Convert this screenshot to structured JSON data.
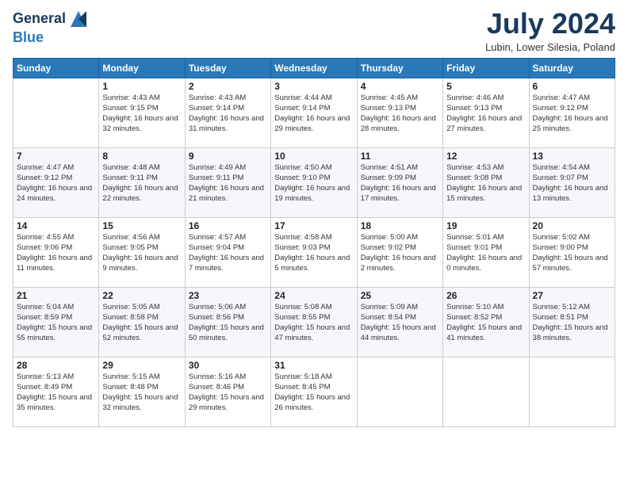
{
  "header": {
    "logo_line1": "General",
    "logo_line2": "Blue",
    "month": "July 2024",
    "location": "Lubin, Lower Silesia, Poland"
  },
  "weekdays": [
    "Sunday",
    "Monday",
    "Tuesday",
    "Wednesday",
    "Thursday",
    "Friday",
    "Saturday"
  ],
  "weeks": [
    [
      {
        "day": "",
        "sunrise": "",
        "sunset": "",
        "daylight": ""
      },
      {
        "day": "1",
        "sunrise": "Sunrise: 4:43 AM",
        "sunset": "Sunset: 9:15 PM",
        "daylight": "Daylight: 16 hours and 32 minutes."
      },
      {
        "day": "2",
        "sunrise": "Sunrise: 4:43 AM",
        "sunset": "Sunset: 9:14 PM",
        "daylight": "Daylight: 16 hours and 31 minutes."
      },
      {
        "day": "3",
        "sunrise": "Sunrise: 4:44 AM",
        "sunset": "Sunset: 9:14 PM",
        "daylight": "Daylight: 16 hours and 29 minutes."
      },
      {
        "day": "4",
        "sunrise": "Sunrise: 4:45 AM",
        "sunset": "Sunset: 9:13 PM",
        "daylight": "Daylight: 16 hours and 28 minutes."
      },
      {
        "day": "5",
        "sunrise": "Sunrise: 4:46 AM",
        "sunset": "Sunset: 9:13 PM",
        "daylight": "Daylight: 16 hours and 27 minutes."
      },
      {
        "day": "6",
        "sunrise": "Sunrise: 4:47 AM",
        "sunset": "Sunset: 9:12 PM",
        "daylight": "Daylight: 16 hours and 25 minutes."
      }
    ],
    [
      {
        "day": "7",
        "sunrise": "Sunrise: 4:47 AM",
        "sunset": "Sunset: 9:12 PM",
        "daylight": "Daylight: 16 hours and 24 minutes."
      },
      {
        "day": "8",
        "sunrise": "Sunrise: 4:48 AM",
        "sunset": "Sunset: 9:11 PM",
        "daylight": "Daylight: 16 hours and 22 minutes."
      },
      {
        "day": "9",
        "sunrise": "Sunrise: 4:49 AM",
        "sunset": "Sunset: 9:11 PM",
        "daylight": "Daylight: 16 hours and 21 minutes."
      },
      {
        "day": "10",
        "sunrise": "Sunrise: 4:50 AM",
        "sunset": "Sunset: 9:10 PM",
        "daylight": "Daylight: 16 hours and 19 minutes."
      },
      {
        "day": "11",
        "sunrise": "Sunrise: 4:51 AM",
        "sunset": "Sunset: 9:09 PM",
        "daylight": "Daylight: 16 hours and 17 minutes."
      },
      {
        "day": "12",
        "sunrise": "Sunrise: 4:53 AM",
        "sunset": "Sunset: 9:08 PM",
        "daylight": "Daylight: 16 hours and 15 minutes."
      },
      {
        "day": "13",
        "sunrise": "Sunrise: 4:54 AM",
        "sunset": "Sunset: 9:07 PM",
        "daylight": "Daylight: 16 hours and 13 minutes."
      }
    ],
    [
      {
        "day": "14",
        "sunrise": "Sunrise: 4:55 AM",
        "sunset": "Sunset: 9:06 PM",
        "daylight": "Daylight: 16 hours and 11 minutes."
      },
      {
        "day": "15",
        "sunrise": "Sunrise: 4:56 AM",
        "sunset": "Sunset: 9:05 PM",
        "daylight": "Daylight: 16 hours and 9 minutes."
      },
      {
        "day": "16",
        "sunrise": "Sunrise: 4:57 AM",
        "sunset": "Sunset: 9:04 PM",
        "daylight": "Daylight: 16 hours and 7 minutes."
      },
      {
        "day": "17",
        "sunrise": "Sunrise: 4:58 AM",
        "sunset": "Sunset: 9:03 PM",
        "daylight": "Daylight: 16 hours and 5 minutes."
      },
      {
        "day": "18",
        "sunrise": "Sunrise: 5:00 AM",
        "sunset": "Sunset: 9:02 PM",
        "daylight": "Daylight: 16 hours and 2 minutes."
      },
      {
        "day": "19",
        "sunrise": "Sunrise: 5:01 AM",
        "sunset": "Sunset: 9:01 PM",
        "daylight": "Daylight: 16 hours and 0 minutes."
      },
      {
        "day": "20",
        "sunrise": "Sunrise: 5:02 AM",
        "sunset": "Sunset: 9:00 PM",
        "daylight": "Daylight: 15 hours and 57 minutes."
      }
    ],
    [
      {
        "day": "21",
        "sunrise": "Sunrise: 5:04 AM",
        "sunset": "Sunset: 8:59 PM",
        "daylight": "Daylight: 15 hours and 55 minutes."
      },
      {
        "day": "22",
        "sunrise": "Sunrise: 5:05 AM",
        "sunset": "Sunset: 8:58 PM",
        "daylight": "Daylight: 15 hours and 52 minutes."
      },
      {
        "day": "23",
        "sunrise": "Sunrise: 5:06 AM",
        "sunset": "Sunset: 8:56 PM",
        "daylight": "Daylight: 15 hours and 50 minutes."
      },
      {
        "day": "24",
        "sunrise": "Sunrise: 5:08 AM",
        "sunset": "Sunset: 8:55 PM",
        "daylight": "Daylight: 15 hours and 47 minutes."
      },
      {
        "day": "25",
        "sunrise": "Sunrise: 5:09 AM",
        "sunset": "Sunset: 8:54 PM",
        "daylight": "Daylight: 15 hours and 44 minutes."
      },
      {
        "day": "26",
        "sunrise": "Sunrise: 5:10 AM",
        "sunset": "Sunset: 8:52 PM",
        "daylight": "Daylight: 15 hours and 41 minutes."
      },
      {
        "day": "27",
        "sunrise": "Sunrise: 5:12 AM",
        "sunset": "Sunset: 8:51 PM",
        "daylight": "Daylight: 15 hours and 38 minutes."
      }
    ],
    [
      {
        "day": "28",
        "sunrise": "Sunrise: 5:13 AM",
        "sunset": "Sunset: 8:49 PM",
        "daylight": "Daylight: 15 hours and 35 minutes."
      },
      {
        "day": "29",
        "sunrise": "Sunrise: 5:15 AM",
        "sunset": "Sunset: 8:48 PM",
        "daylight": "Daylight: 15 hours and 32 minutes."
      },
      {
        "day": "30",
        "sunrise": "Sunrise: 5:16 AM",
        "sunset": "Sunset: 8:46 PM",
        "daylight": "Daylight: 15 hours and 29 minutes."
      },
      {
        "day": "31",
        "sunrise": "Sunrise: 5:18 AM",
        "sunset": "Sunset: 8:45 PM",
        "daylight": "Daylight: 15 hours and 26 minutes."
      },
      {
        "day": "",
        "sunrise": "",
        "sunset": "",
        "daylight": ""
      },
      {
        "day": "",
        "sunrise": "",
        "sunset": "",
        "daylight": ""
      },
      {
        "day": "",
        "sunrise": "",
        "sunset": "",
        "daylight": ""
      }
    ]
  ]
}
